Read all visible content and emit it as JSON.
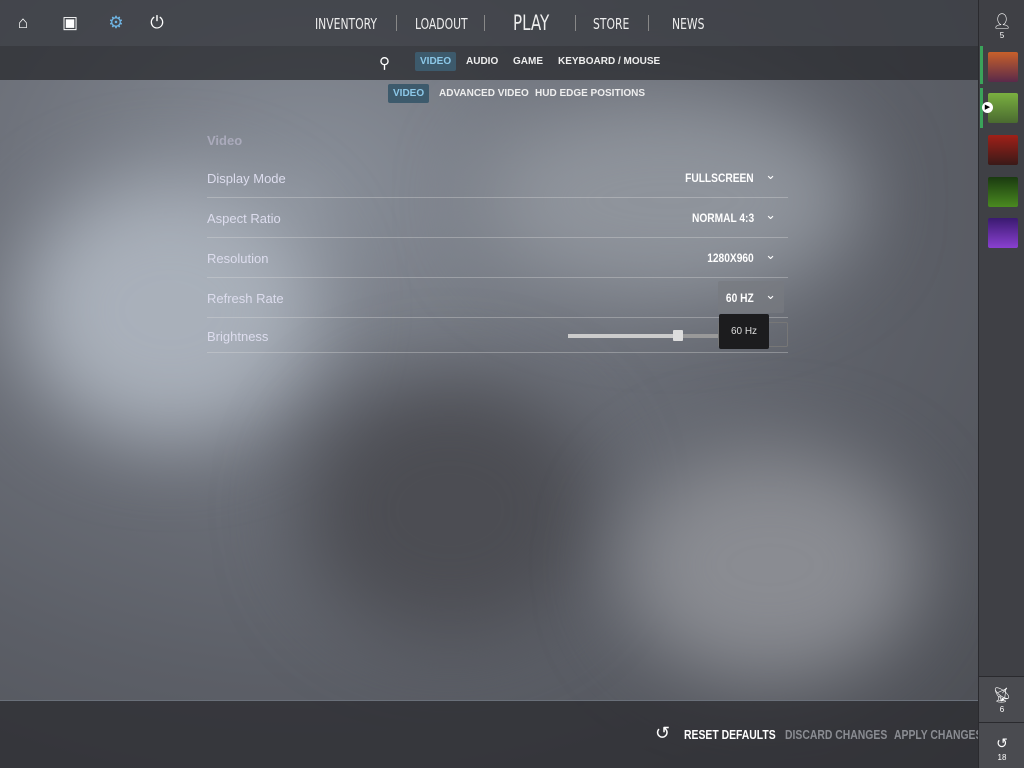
{
  "topnav": {
    "icons": [
      "home-icon",
      "tv-icon",
      "gear-icon",
      "power-icon"
    ],
    "items": [
      "INVENTORY",
      "LOADOUT",
      "PLAY",
      "STORE",
      "NEWS"
    ]
  },
  "tabs": [
    "VIDEO",
    "AUDIO",
    "GAME",
    "KEYBOARD / MOUSE"
  ],
  "subtabs": [
    "VIDEO",
    "ADVANCED VIDEO",
    "HUD EDGE POSITIONS"
  ],
  "section": {
    "title": "Video",
    "rows": [
      {
        "label": "Display Mode",
        "value": "FULLSCREEN"
      },
      {
        "label": "Aspect Ratio",
        "value": "NORMAL 4:3"
      },
      {
        "label": "Resolution",
        "value": "1280X960"
      },
      {
        "label": "Refresh Rate",
        "value": "60 HZ"
      },
      {
        "label": "Brightness",
        "slider_fraction": 0.73
      }
    ]
  },
  "tooltip": "60 Hz",
  "footer": {
    "reset": "RESET DEFAULTS",
    "discard": "DISCARD CHANGES",
    "apply": "APPLY CHANGES"
  },
  "rightbar": {
    "friends_count": "5",
    "signal_count": "6",
    "history_count": "18"
  },
  "colors": {
    "accent": "#8cc8e8",
    "active_tab_bg": "#3d5a6c",
    "online": "#3aa35a"
  }
}
